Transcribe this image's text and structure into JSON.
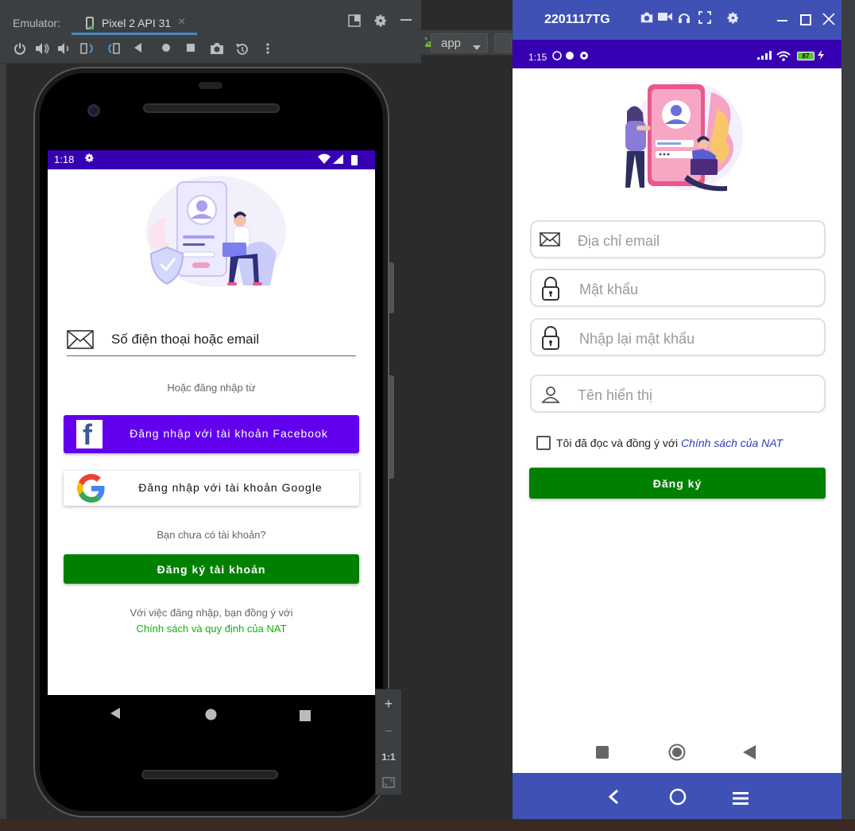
{
  "emulator": {
    "label": "Emulator:",
    "tab_label": "Pixel 2 API 31",
    "tab_close": "×",
    "zoom": {
      "plus": "+",
      "minus": "−",
      "one_to_one": "1:1"
    }
  },
  "ide": {
    "run_config": "app"
  },
  "login_screen": {
    "status_time": "1:18",
    "email_input_text": "Số điện thoại hoặc email",
    "or_text": "Hoặc đăng nhập từ",
    "facebook_button": "Đăng nhập với tài khoản Facebook",
    "facebook_logo_letter": "f",
    "google_button": "Đăng nhập với tài khoản Google",
    "no_account_text": "Bạn chưa có tài khoản?",
    "register_button": "Đăng ký tài khoản",
    "agree_text": "Với việc đăng nhập, bạn đồng ý với",
    "policy_link": "Chính sách và quy định của NAT",
    "colors": {
      "status_bar": "#3700b3",
      "facebook": "#6200ee",
      "register": "#008000",
      "policy": "#10b010"
    }
  },
  "mirror_window": {
    "title": "2201117TG",
    "status_time": "1:15",
    "battery": "87",
    "fields": {
      "email_placeholder": "Địa chỉ email",
      "password_placeholder": "Mật khẩu",
      "confirm_password_placeholder": "Nhập lại mật khẩu",
      "display_name_placeholder": "Tên hiển thị"
    },
    "checkbox_text": "Tôi đã đọc và đồng ý với",
    "checkbox_link": "Chính sách của NAT",
    "register_button": "Đăng ký",
    "colors": {
      "title_bar": "#3f51b5",
      "status_bar": "#3700b3",
      "button": "#008000",
      "link": "#2e3cb8"
    }
  }
}
